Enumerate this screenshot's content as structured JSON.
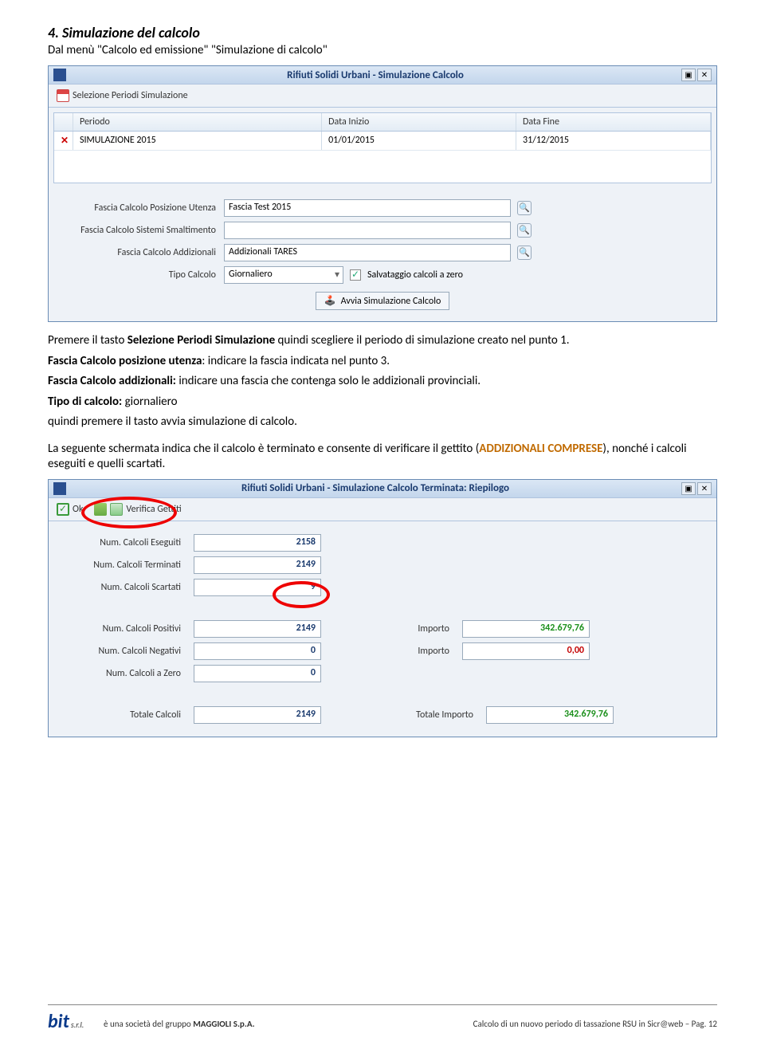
{
  "section": {
    "title": "4. Simulazione del calcolo",
    "intro": "Dal menù \"Calcolo ed emissione\"   \"Simulazione di calcolo\""
  },
  "window1": {
    "title": "Rifiuti Solidi Urbani - Simulazione Calcolo",
    "toolbar_btn": "Selezione Periodi Simulazione",
    "cols": {
      "periodo": "Periodo",
      "di": "Data Inizio",
      "df": "Data Fine"
    },
    "row": {
      "periodo": "SIMULAZIONE 2015",
      "di": "01/01/2015",
      "df": "31/12/2015"
    },
    "labels": {
      "l1": "Fascia Calcolo Posizione Utenza",
      "l2": "Fascia Calcolo Sistemi Smaltimento",
      "l3": "Fascia Calcolo Addizionali",
      "l4": "Tipo Calcolo",
      "chk": "Salvataggio calcoli a zero",
      "run": "Avvia Simulazione Calcolo"
    },
    "vals": {
      "v1": "Fascia Test 2015",
      "v2": "",
      "v3": "Addizionali TARES",
      "v4": "Giornaliero"
    }
  },
  "body": {
    "p1_pre": "Premere il tasto ",
    "p1_b": "Selezione Periodi Simulazione",
    "p1_post": " quindi scegliere il periodo di simulazione creato nel punto 1.",
    "p2_b": "Fascia Calcolo posizione utenza",
    "p2_post": ": indicare la fascia indicata nel punto 3.",
    "p3_b": "Fascia Calcolo addizionali:",
    "p3_post": " indicare una fascia che contenga solo le addizionali provinciali.",
    "p4_b": "Tipo di calcolo:",
    "p4_post": " giornaliero",
    "p5": "quindi premere il tasto avvia simulazione di calcolo.",
    "p6_pre": "La seguente schermata indica che il calcolo è terminato e consente di verificare il gettito (",
    "p6_b": "ADDIZIONALI COMPRESE",
    "p6_post": "), nonché i calcoli eseguiti e quelli scartati."
  },
  "window2": {
    "title": "Rifiuti Solidi Urbani - Simulazione Calcolo Terminata: Riepilogo",
    "btns": {
      "ok": "Ok",
      "vg": "Verifica Gettiti"
    },
    "labels": {
      "l1": "Num. Calcoli Eseguiti",
      "l2": "Num. Calcoli Terminati",
      "l3": "Num. Calcoli Scartati",
      "l4": "Num. Calcoli Positivi",
      "l5": "Num. Calcoli Negativi",
      "l6": "Num. Calcoli a Zero",
      "imp": "Importo",
      "tot": "Totale Calcoli",
      "totimp": "Totale Importo"
    },
    "vals": {
      "v1": "2158",
      "v2": "2149",
      "v3": "9",
      "v4": "2149",
      "v5": "0",
      "v6": "0",
      "imp1": "342.679,76",
      "imp2": "0,00",
      "tot": "2149",
      "totimp": "342.679,76"
    }
  },
  "footer": {
    "left": "è una società del gruppo ",
    "left_b": "MAGGIOLI S.p.A.",
    "right": "Calcolo di un nuovo periodo di tassazione RSU in Sicr@web – Pag. 12"
  }
}
